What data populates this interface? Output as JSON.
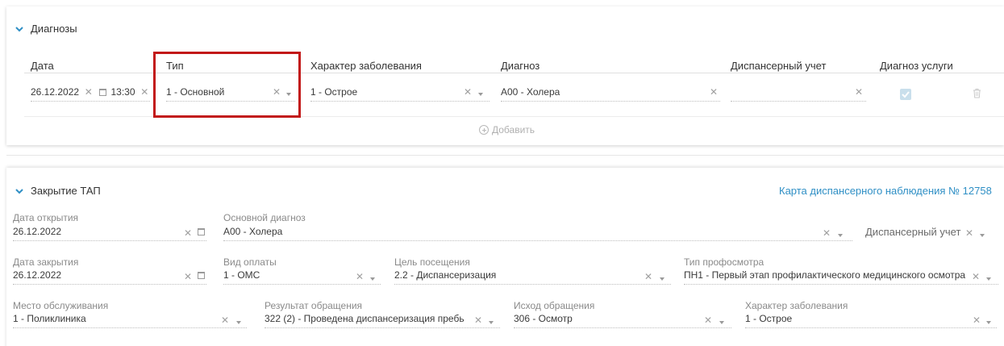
{
  "diagnoses": {
    "title": "Диагнозы",
    "columns": {
      "date": "Дата",
      "type": "Тип",
      "character": "Характер заболевания",
      "diagnosis": "Диагноз",
      "dispensary": "Диспансерный учет",
      "service_diagnosis": "Диагноз услуги"
    },
    "row": {
      "date": "26.12.2022",
      "time": "13:30",
      "type": "1 - Основной",
      "character": "1 - Острое",
      "diagnosis": "A00 - Холера",
      "dispensary": "",
      "service_diagnosis_checked": true
    },
    "add_label": "Добавить"
  },
  "closure": {
    "title": "Закрытие ТАП",
    "card_link": "Карта диспансерного наблюдения № 12758",
    "open_date": {
      "label": "Дата открытия",
      "value": "26.12.2022"
    },
    "main_diagnosis": {
      "label": "Основной диагноз",
      "value": "A00 - Холера"
    },
    "dispensary": {
      "placeholder": "Диспансерный учет"
    },
    "close_date": {
      "label": "Дата закрытия",
      "value": "26.12.2022"
    },
    "payment": {
      "label": "Вид оплаты",
      "value": "1 - ОМС"
    },
    "visit_goal": {
      "label": "Цель посещения",
      "value": "2.2 - Диспансеризация"
    },
    "checkup_type": {
      "label": "Тип профосмотра",
      "value": "ПН1 - Первый этап профилактического медицинского осмотра"
    },
    "place": {
      "label": "Место обслуживания",
      "value": "1 - Поликлиника"
    },
    "result": {
      "label": "Результат обращения",
      "value": "322 (2)  - Проведена диспансеризация пребь"
    },
    "outcome": {
      "label": "Исход обращения",
      "value": "306 - Осмотр"
    },
    "character": {
      "label": "Характер заболевания",
      "value": "1 - Острое"
    }
  },
  "colors": {
    "accent": "#2f8fc5",
    "highlight": "#c21818"
  }
}
